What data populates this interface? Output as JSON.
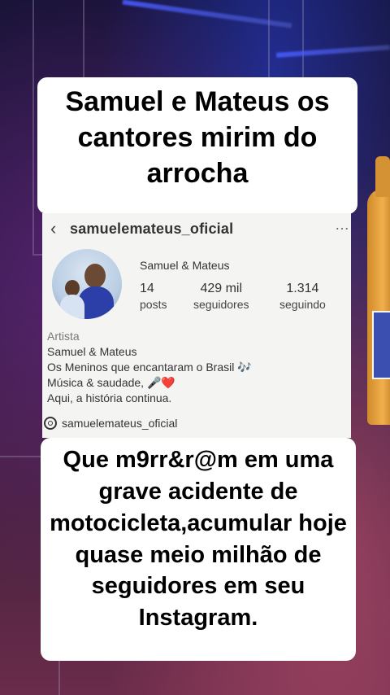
{
  "captions": {
    "top": "Samuel e Mateus os cantores mirim do arrocha",
    "bottom": "Que m9rr&r@m em uma grave acidente de motocicleta,acumular hoje quase meio milhão de seguidores em seu Instagram."
  },
  "profile": {
    "back_icon": "‹",
    "handle": "samuelemateus_oficial",
    "more_icon": "…",
    "display_name": "Samuel & Mateus",
    "stats": [
      {
        "value": "14",
        "label": "posts"
      },
      {
        "value": "429 mil",
        "label": "seguidores"
      },
      {
        "value": "1.314",
        "label": "seguindo"
      }
    ],
    "bio": {
      "category": "Artista",
      "lines": [
        "Samuel & Mateus",
        "Os Meninos que encantaram o Brasil 🎶",
        "Música & saudade, 🎤❤️",
        "Aqui, a história continua."
      ]
    },
    "threads_link": "samuelemateus_oficial"
  },
  "colors": {
    "caption_bg": "#ffffff",
    "panel_bg": "#f4f4f2"
  }
}
